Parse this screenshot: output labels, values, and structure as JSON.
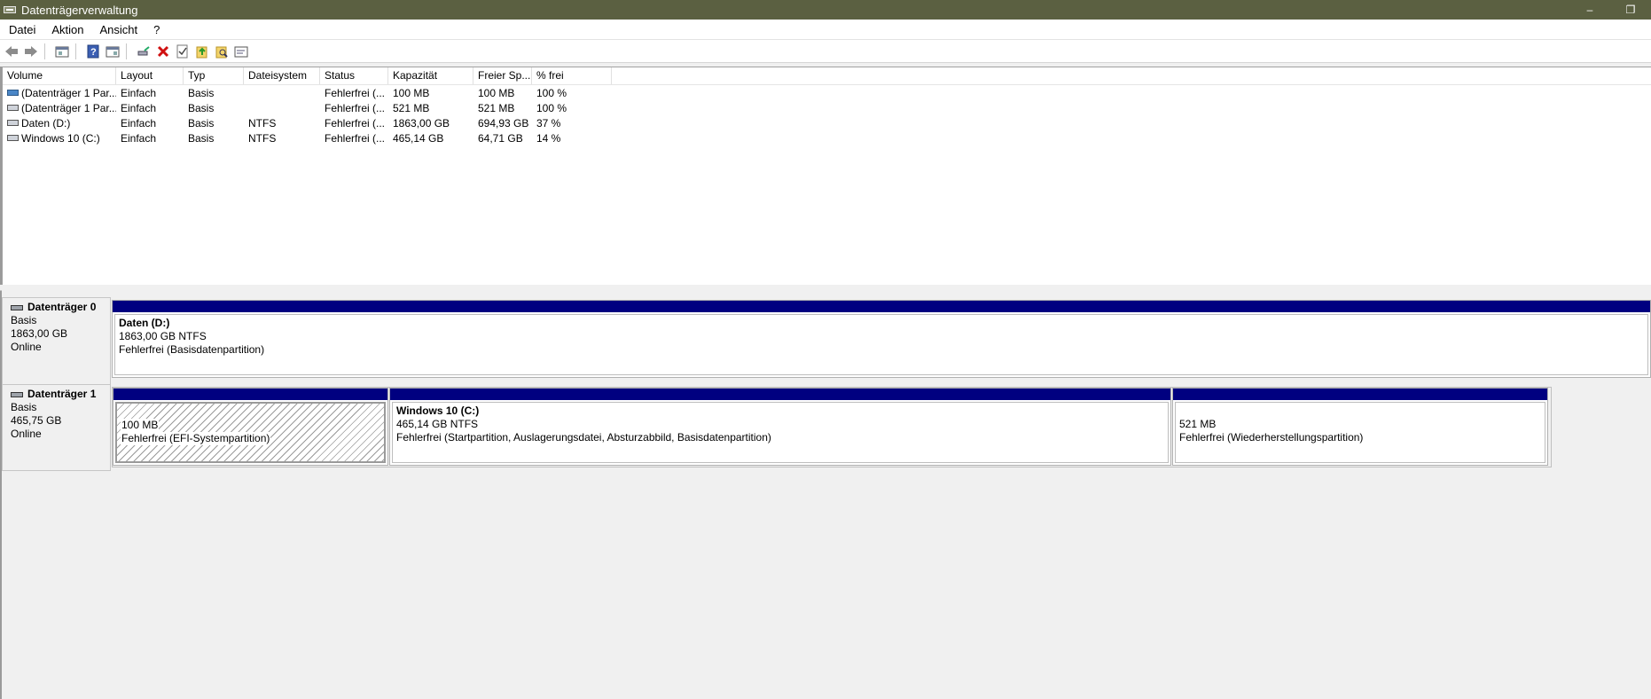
{
  "window": {
    "title": "Datenträgerverwaltung",
    "controls": [
      "–",
      "❐"
    ]
  },
  "menu": [
    "Datei",
    "Aktion",
    "Ansicht",
    "?"
  ],
  "toolbar": {
    "icons": [
      "back-arrow-icon",
      "forward-arrow-icon",
      "disk-view-icon",
      "help-icon",
      "console-icon",
      "connect-icon",
      "delete-icon",
      "check-icon",
      "folder-up-icon",
      "folder-search-icon",
      "properties-icon"
    ]
  },
  "volume_list": {
    "columns": [
      "Volume",
      "Layout",
      "Typ",
      "Dateisystem",
      "Status",
      "Kapazität",
      "Freier Sp...",
      "% frei"
    ],
    "rows": [
      {
        "volume": "(Datenträger 1 Par...",
        "layout": "Einfach",
        "typ": "Basis",
        "dateisystem": "",
        "status": "Fehlerfrei (...",
        "kapazitaet": "100 MB",
        "frei": "100 MB",
        "prozent": "100 %",
        "icon": "blue"
      },
      {
        "volume": "(Datenträger 1 Par...",
        "layout": "Einfach",
        "typ": "Basis",
        "dateisystem": "",
        "status": "Fehlerfrei (...",
        "kapazitaet": "521 MB",
        "frei": "521 MB",
        "prozent": "100 %",
        "icon": "gray"
      },
      {
        "volume": "Daten (D:)",
        "layout": "Einfach",
        "typ": "Basis",
        "dateisystem": "NTFS",
        "status": "Fehlerfrei (...",
        "kapazitaet": "1863,00 GB",
        "frei": "694,93 GB",
        "prozent": "37 %",
        "icon": "gray"
      },
      {
        "volume": "Windows 10 (C:)",
        "layout": "Einfach",
        "typ": "Basis",
        "dateisystem": "NTFS",
        "status": "Fehlerfrei (...",
        "kapazitaet": "465,14 GB",
        "frei": "64,71 GB",
        "prozent": "14 %",
        "icon": "gray"
      }
    ]
  },
  "disks": [
    {
      "name": "Datenträger 0",
      "type": "Basis",
      "size": "1863,00 GB",
      "state": "Online",
      "partitions": [
        {
          "name": "Daten  (D:)",
          "size": "1863,00 GB NTFS",
          "status": "Fehlerfrei (Basisdatenpartition)"
        }
      ]
    },
    {
      "name": "Datenträger 1",
      "type": "Basis",
      "size": "465,75 GB",
      "state": "Online",
      "partitions": [
        {
          "name": "",
          "size": "100 MB",
          "status": "Fehlerfrei (EFI-Systempartition)"
        },
        {
          "name": "Windows 10  (C:)",
          "size": "465,14 GB NTFS",
          "status": "Fehlerfrei (Startpartition, Auslagerungsdatei, Absturzabbild, Basisdatenpartition)"
        },
        {
          "name": "",
          "size": "521 MB",
          "status": "Fehlerfrei (Wiederherstellungspartition)"
        }
      ]
    }
  ],
  "colors": {
    "titlebar": "#5b6041",
    "partition_bar": "#000080"
  }
}
